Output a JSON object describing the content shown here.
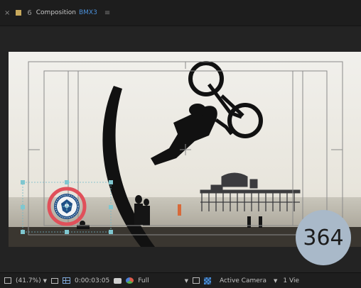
{
  "tabbar": {
    "close_glyph": "×",
    "lock_glyph": "6",
    "label": "Composition",
    "comp_name": "BMX3",
    "menu_glyph": "≡"
  },
  "footer": {
    "zoom": "(41.7%)",
    "timecode": "0:00:03:05",
    "resolution": "Full",
    "camera": "Active Camera",
    "views": "1 Vie"
  },
  "page_number": "364",
  "colors": {
    "accent_blue": "#4a8fd8",
    "swatch": "#c8a95c",
    "badge": "#a9b9c9",
    "selection_ring": "#e0505a"
  }
}
